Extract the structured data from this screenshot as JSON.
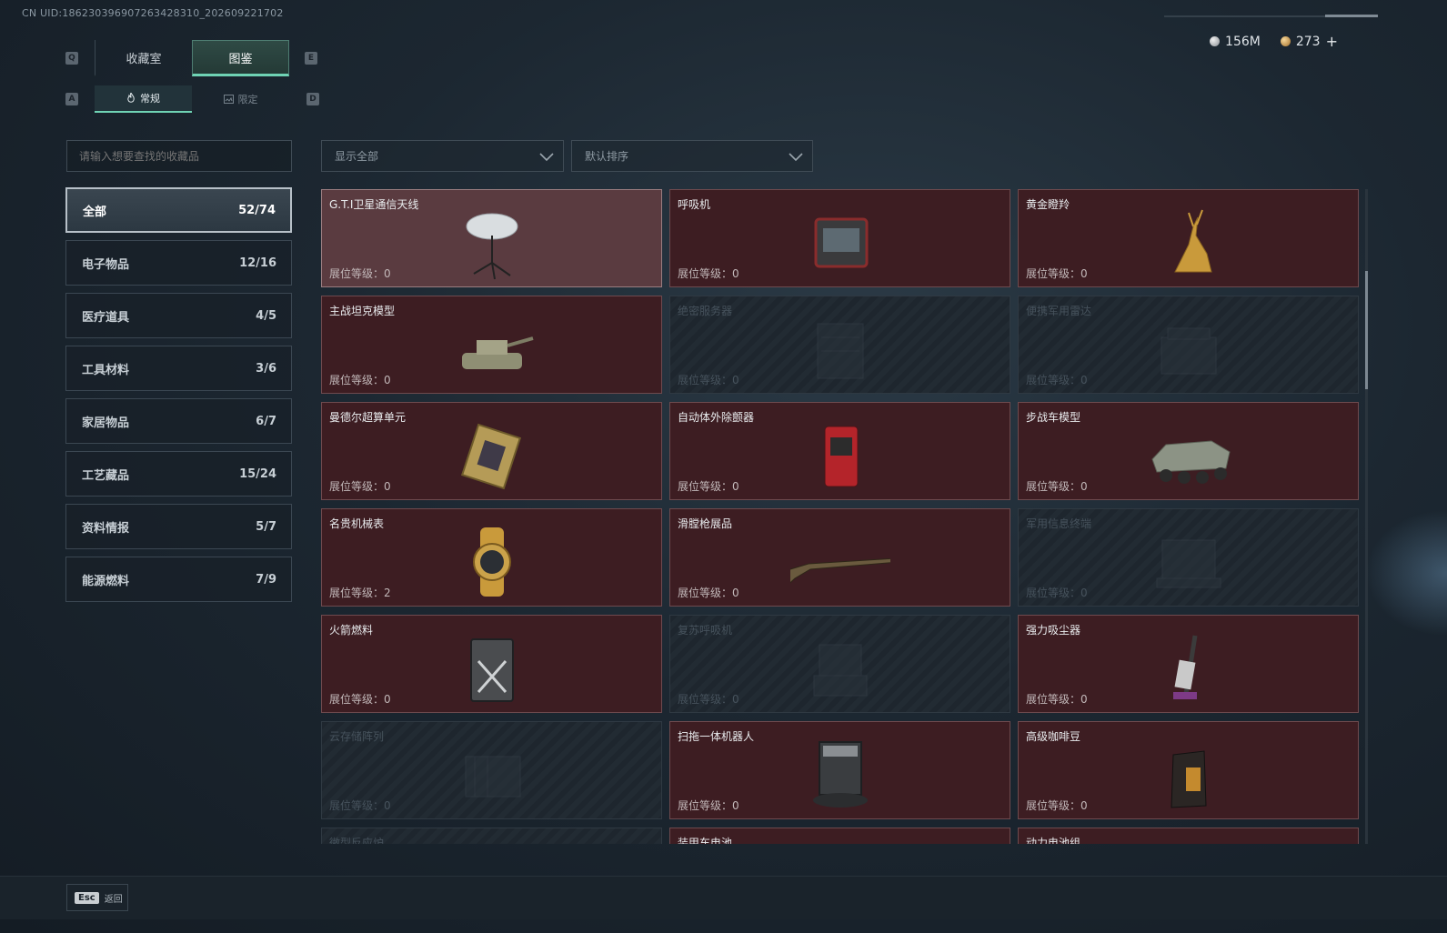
{
  "header": {
    "uid": "CN UID:1862303969072634283​10_202609221702"
  },
  "keys": {
    "left_tab": "Q",
    "right_tab": "E",
    "left_sub": "A",
    "right_sub": "D"
  },
  "main_tabs": [
    {
      "label": "收藏室",
      "active": false
    },
    {
      "label": "图鉴",
      "active": true
    }
  ],
  "sub_tabs": [
    {
      "label": "常规",
      "icon": "flame-icon",
      "active": true
    },
    {
      "label": "限定",
      "icon": "image-icon",
      "active": false
    }
  ],
  "currency": {
    "silver": "156M",
    "gold": "273",
    "add": "+"
  },
  "search": {
    "placeholder": "请输入想要查找的收藏品"
  },
  "filters": {
    "show": "显示全部",
    "sort": "默认排序"
  },
  "categories": [
    {
      "label": "全部",
      "count": "52/74",
      "active": true
    },
    {
      "label": "电子物品",
      "count": "12/16"
    },
    {
      "label": "医疗道具",
      "count": "4/5"
    },
    {
      "label": "工具材料",
      "count": "3/6"
    },
    {
      "label": "家居物品",
      "count": "6/7"
    },
    {
      "label": "工艺藏品",
      "count": "15/24"
    },
    {
      "label": "资料情报",
      "count": "5/7"
    },
    {
      "label": "能源燃料",
      "count": "7/9"
    }
  ],
  "level_prefix": "展位等级：",
  "items": [
    {
      "name": "G.T.I卫星通信天线",
      "level": "0",
      "state": "selected",
      "icon": "satellite-dish-icon"
    },
    {
      "name": "呼吸机",
      "level": "0",
      "state": "owned",
      "icon": "ventilator-icon"
    },
    {
      "name": "黄金瞪羚",
      "level": "0",
      "state": "owned",
      "icon": "golden-gazelle-icon"
    },
    {
      "name": "主战坦克模型",
      "level": "0",
      "state": "owned",
      "icon": "tank-model-icon"
    },
    {
      "name": "绝密服务器",
      "level": "0",
      "state": "locked",
      "icon": "server-icon"
    },
    {
      "name": "便携军用雷达",
      "level": "0",
      "state": "locked",
      "icon": "radar-icon"
    },
    {
      "name": "曼德尔超算单元",
      "level": "0",
      "state": "owned",
      "icon": "supercomputer-unit-icon"
    },
    {
      "name": "自动体外除颤器",
      "level": "0",
      "state": "owned",
      "icon": "defibrillator-icon"
    },
    {
      "name": "步战车模型",
      "level": "0",
      "state": "owned",
      "icon": "ifv-model-icon"
    },
    {
      "name": "名贵机械表",
      "level": "2",
      "state": "owned",
      "icon": "watch-icon"
    },
    {
      "name": "滑膛枪展品",
      "level": "0",
      "state": "owned",
      "icon": "musket-icon"
    },
    {
      "name": "军用信息终端",
      "level": "0",
      "state": "locked",
      "icon": "terminal-icon"
    },
    {
      "name": "火箭燃料",
      "level": "0",
      "state": "owned",
      "icon": "fuel-can-icon"
    },
    {
      "name": "复苏呼吸机",
      "level": "0",
      "state": "locked",
      "icon": "resuscitator-icon"
    },
    {
      "name": "强力吸尘器",
      "level": "0",
      "state": "owned",
      "icon": "vacuum-icon"
    },
    {
      "name": "云存储阵列",
      "level": "0",
      "state": "locked",
      "icon": "storage-array-icon"
    },
    {
      "name": "扫拖一体机器人",
      "level": "0",
      "state": "owned",
      "icon": "robot-vacuum-icon"
    },
    {
      "name": "高级咖啡豆",
      "level": "0",
      "state": "owned",
      "icon": "coffee-bag-icon"
    },
    {
      "name": "微型反应炉",
      "level": "",
      "state": "locked",
      "icon": "reactor-icon"
    },
    {
      "name": "装甲车电池",
      "level": "",
      "state": "owned",
      "icon": "battery-icon"
    },
    {
      "name": "动力电池组",
      "level": "",
      "state": "owned",
      "icon": "battery-pack-icon"
    }
  ],
  "footer": {
    "esc_key": "Esc",
    "back_label": "返回"
  }
}
